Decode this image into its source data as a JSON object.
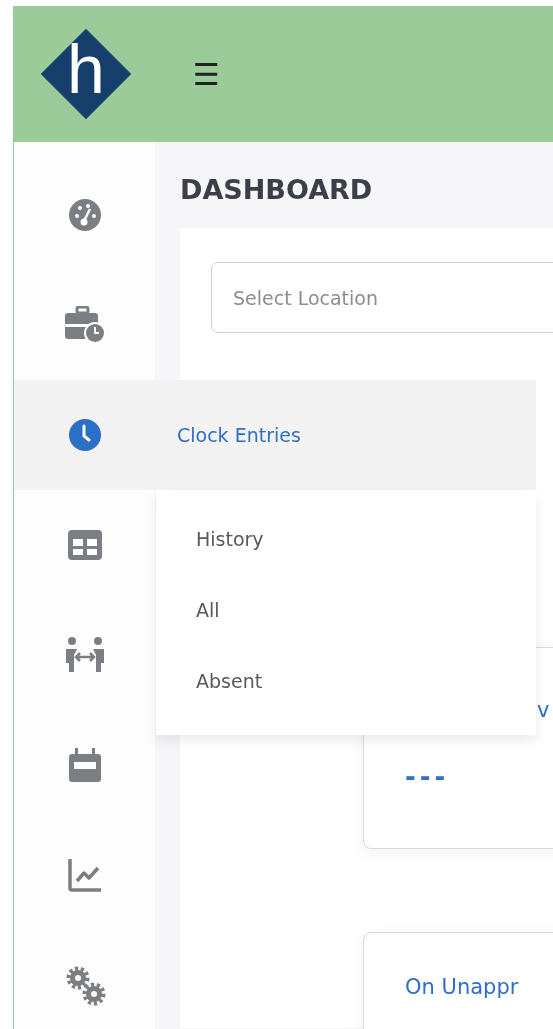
{
  "header": {
    "logo_letter": "h",
    "menu_glyph": "☰"
  },
  "sidebar": {
    "items": [
      {
        "kind": "gauge",
        "selected": false
      },
      {
        "kind": "briefcase",
        "selected": false
      },
      {
        "kind": "clock",
        "selected": true
      },
      {
        "kind": "table",
        "selected": false
      },
      {
        "kind": "people",
        "selected": false
      },
      {
        "kind": "calendar",
        "selected": false
      },
      {
        "kind": "chart",
        "selected": false
      },
      {
        "kind": "gears",
        "selected": false
      }
    ]
  },
  "flyout": {
    "title": "Clock Entries",
    "items": [
      "History",
      "All",
      "Absent"
    ]
  },
  "page_title": "DASHBOARD",
  "location_select": {
    "placeholder": "Select Location"
  },
  "cards": [
    {
      "title": "v",
      "value": "---"
    },
    {
      "title": "On Unappr"
    }
  ]
}
